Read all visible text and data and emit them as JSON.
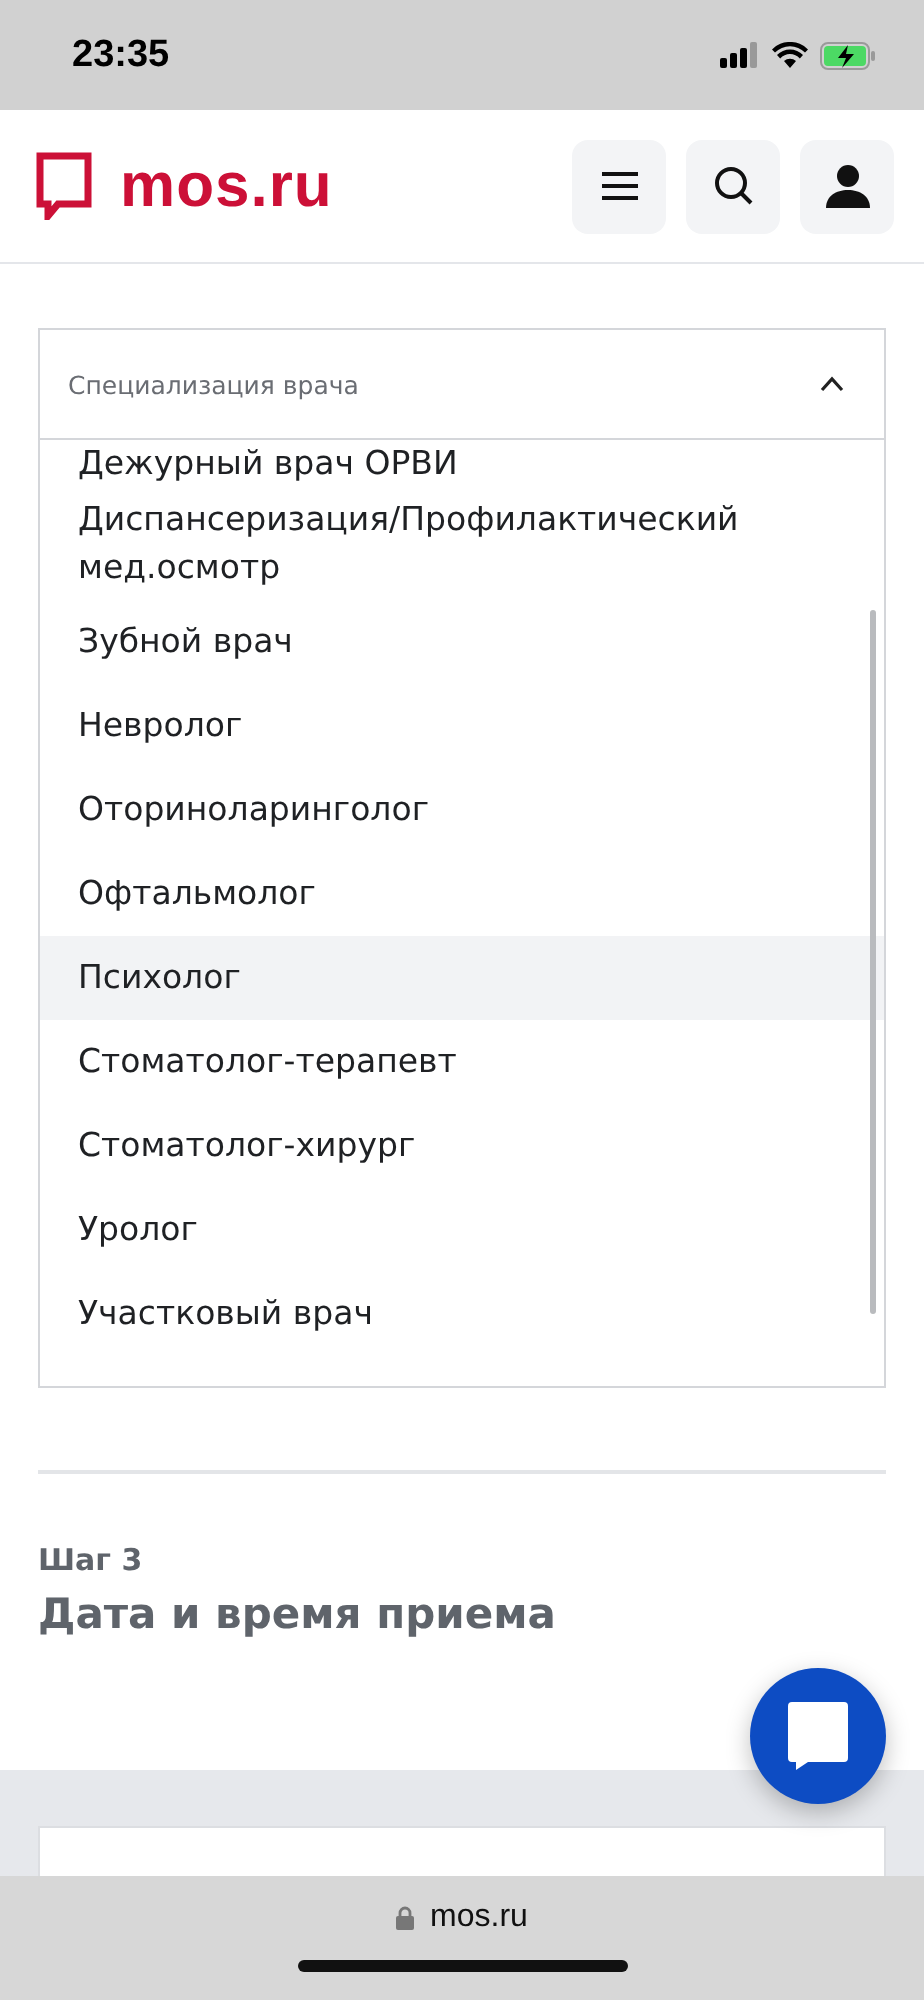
{
  "status_bar": {
    "time": "23:35"
  },
  "header": {
    "logo": "mos.ru"
  },
  "select": {
    "label": "Специализация врача",
    "expanded": true,
    "options": [
      {
        "label": "Дежурный врач ОРВИ",
        "selected": false
      },
      {
        "label": "Диспансеризация/Профилактический мед.осмотр",
        "selected": false
      },
      {
        "label": "Зубной врач",
        "selected": false
      },
      {
        "label": "Невролог",
        "selected": false
      },
      {
        "label": "Оториноларинголог",
        "selected": false
      },
      {
        "label": "Офтальмолог",
        "selected": false
      },
      {
        "label": "Психолог",
        "selected": true
      },
      {
        "label": "Стоматолог-терапевт",
        "selected": false
      },
      {
        "label": "Стоматолог-хирург",
        "selected": false
      },
      {
        "label": "Уролог",
        "selected": false
      },
      {
        "label": "Участковый врач",
        "selected": false
      }
    ]
  },
  "step": {
    "label": "Шаг 3",
    "title": "Дата и время приема"
  },
  "browser_bar": {
    "url": "mos.ru"
  }
}
